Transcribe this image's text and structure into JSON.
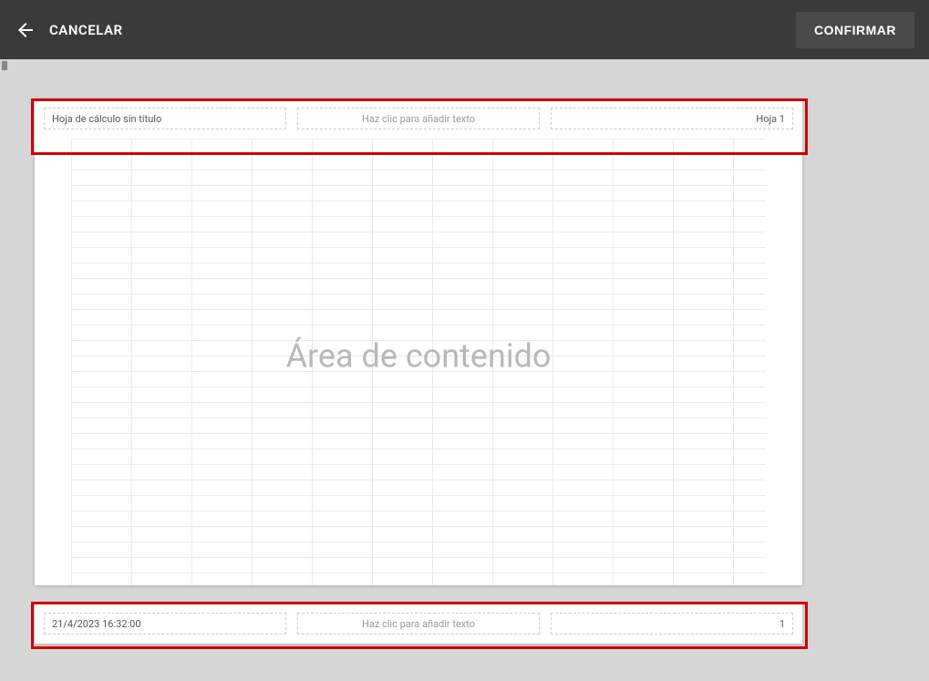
{
  "topbar": {
    "cancel": "CANCELAR",
    "confirm": "CONFIRMAR"
  },
  "header_fields": {
    "left": "Hoja de cálculo sin título",
    "center": "Haz clic para añadir texto",
    "right": "Hoja 1"
  },
  "content_placeholder": "Área de contenido",
  "footer_fields": {
    "left": "21/4/2023 16:32:00",
    "center": "Haz clic para añadir texto",
    "right": "1"
  }
}
